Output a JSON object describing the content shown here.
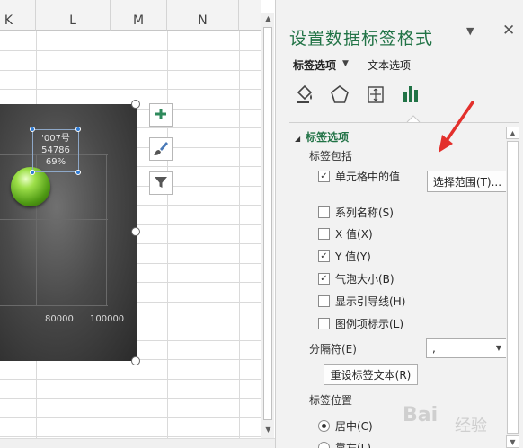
{
  "sheet": {
    "columns": [
      "K",
      "L",
      "M",
      "N"
    ]
  },
  "chart": {
    "data_label": {
      "name": "'007号",
      "value": "54786",
      "size": "69%"
    },
    "x_ticks": [
      "80000",
      "100000"
    ],
    "bubble_color": "#7cc430",
    "tools": {
      "add_icon": "plus-icon",
      "style_icon": "brush-icon",
      "filter_icon": "filter-icon"
    }
  },
  "pane": {
    "title": "设置数据标签格式",
    "collapse_glyph": "▼",
    "close_glyph": "✕",
    "tabs": {
      "label_options": "标签选项",
      "text_options": "文本选项",
      "caret": "▼"
    },
    "category_icons": [
      "fill-line-icon",
      "effects-icon",
      "size-properties-icon",
      "label-options-icon"
    ],
    "section": {
      "title": "标签选项",
      "label_contains": "标签包括",
      "options": [
        {
          "label": "单元格中的值",
          "checked": true
        },
        {
          "label": "系列名称(S)",
          "checked": false
        },
        {
          "label": "X 值(X)",
          "checked": false
        },
        {
          "label": "Y 值(Y)",
          "checked": true
        },
        {
          "label": "气泡大小(B)",
          "checked": true
        },
        {
          "label": "显示引导线(H)",
          "checked": false
        },
        {
          "label": "图例项标示(L)",
          "checked": false
        }
      ],
      "select_range_button": "选择范围(T)...",
      "separator_label": "分隔符(E)",
      "separator_value": ",",
      "reset_button": "重设标签文本(R)",
      "position_label": "标签位置",
      "positions": [
        {
          "label": "居中(C)",
          "selected": true
        },
        {
          "label": "靠左(L)",
          "selected": false
        }
      ]
    },
    "accent_color": "#217346"
  },
  "watermark": {
    "text": "Bai",
    "sub": "经验"
  }
}
